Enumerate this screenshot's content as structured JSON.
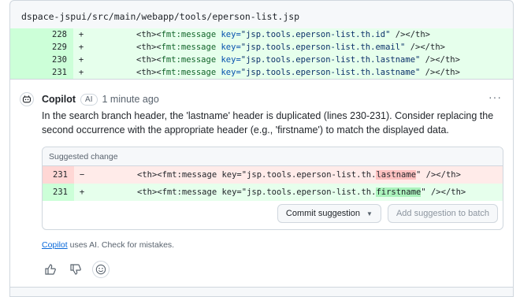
{
  "file": {
    "path": "dspace-jspui/src/main/webapp/tools/eperson-list.jsp"
  },
  "diff_lines": [
    {
      "num": "228",
      "sign": "+",
      "pre": "<th><",
      "tagname": "fmt:message",
      "attr": " key=",
      "val": "\"jsp.tools.eperson-list.th.id\"",
      "post": " /></th>"
    },
    {
      "num": "229",
      "sign": "+",
      "pre": "<th><",
      "tagname": "fmt:message",
      "attr": " key=",
      "val": "\"jsp.tools.eperson-list.th.email\"",
      "post": " /></th>"
    },
    {
      "num": "230",
      "sign": "+",
      "pre": "<th><",
      "tagname": "fmt:message",
      "attr": " key=",
      "val": "\"jsp.tools.eperson-list.th.lastname\"",
      "post": " /></th>"
    },
    {
      "num": "231",
      "sign": "+",
      "pre": "<th><",
      "tagname": "fmt:message",
      "attr": " key=",
      "val": "\"jsp.tools.eperson-list.th.lastname\"",
      "post": " /></th>"
    }
  ],
  "comment": {
    "author": "Copilot",
    "badge": "AI",
    "time": "1 minute ago",
    "menu": "···",
    "body": "In the search branch header, the 'lastname' header is duplicated (lines 230-231). Consider replacing the second occurrence with the appropriate header (e.g., 'firstname') to match the displayed data."
  },
  "suggestion": {
    "title": "Suggested change",
    "removed": {
      "num": "231",
      "sign": "−",
      "pre": "<th><fmt:message key=\"jsp.tools.eperson-list.th.",
      "hl": "lastname",
      "post": "\" /></th>"
    },
    "added": {
      "num": "231",
      "sign": "+",
      "pre": "<th><fmt:message key=\"jsp.tools.eperson-list.th.",
      "hl": "firstname",
      "post": "\" /></th>"
    },
    "commit_label": "Commit suggestion",
    "batch_label": "Add suggestion to batch"
  },
  "disclaimer": {
    "link": "Copilot",
    "text": " uses AI. Check for mistakes."
  },
  "icons": {
    "bot": "copilot-icon",
    "thumbs_up": "thumbs-up-icon",
    "thumbs_down": "thumbs-down-icon",
    "emoji": "smiley-icon"
  },
  "colors": {
    "add_bg": "#e6ffec",
    "del_bg": "#ffebe9",
    "link": "#0969da"
  }
}
